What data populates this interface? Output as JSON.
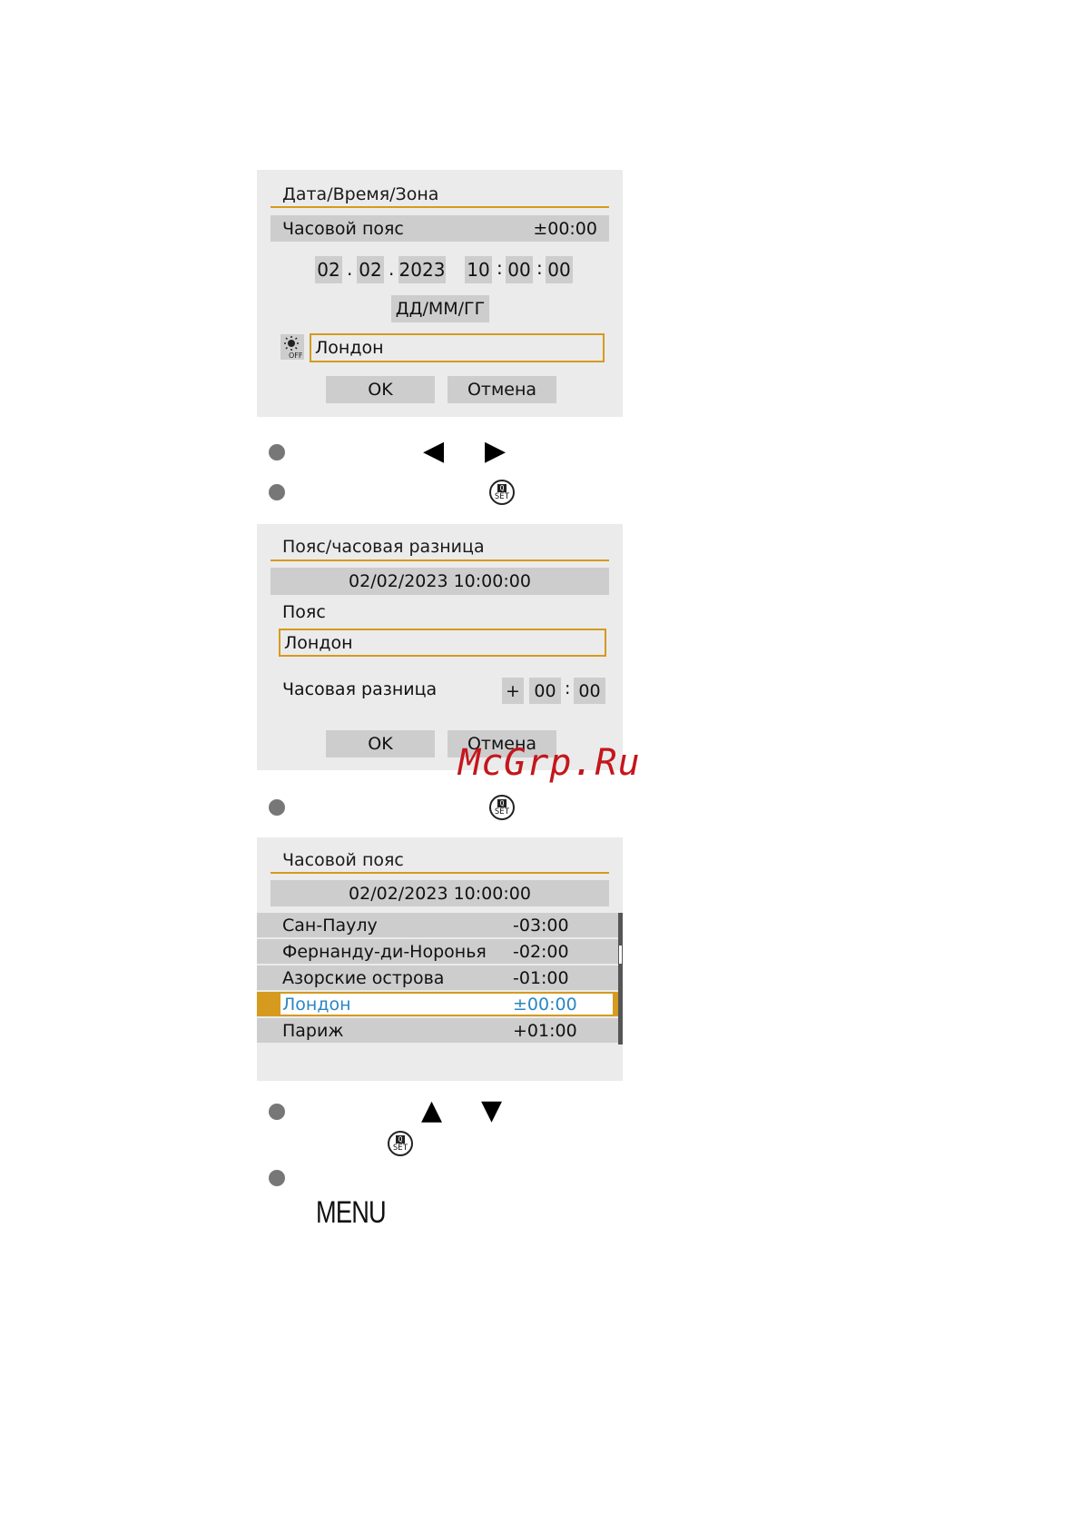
{
  "screen1": {
    "title": "Дата/Время/Зона",
    "zone_label": "Часовой пояс",
    "zone_value": "±00:00",
    "date": {
      "day": "02",
      "month": "02",
      "year": "2023",
      "sep": "."
    },
    "time": {
      "hour": "10",
      "minute": "00",
      "second": "00",
      "sep": ":"
    },
    "format": "ДД/ММ/ГГ",
    "dst_icon": "dst-off-icon",
    "city": "Лондон",
    "ok": "OK",
    "cancel": "Отмена"
  },
  "steps1": {
    "arrow_left": "◀",
    "arrow_right": "▶",
    "set_icon": "q-set-icon"
  },
  "screen2": {
    "title": "Пояс/часовая разница",
    "datetime": "02/02/2023 10:00:00",
    "zone_label": "Пояс",
    "city": "Лондон",
    "diff_label": "Часовая разница",
    "diff_sign": "+",
    "diff_hours": "00",
    "diff_sep": ":",
    "diff_minutes": "00",
    "ok": "OK",
    "cancel": "Отмена"
  },
  "watermark": "McGrp.Ru",
  "screen3": {
    "title": "Часовой пояс",
    "datetime": "02/02/2023 10:00:00",
    "rows": [
      {
        "name": "Сан-Паулу",
        "offset": "-03:00"
      },
      {
        "name": "Фернанду-ди-Норонья",
        "offset": "-02:00"
      },
      {
        "name": "Азорские острова",
        "offset": "-01:00"
      },
      {
        "name": "Лондон",
        "offset": "±00:00"
      },
      {
        "name": "Париж",
        "offset": "+01:00"
      }
    ],
    "selected_index": 3
  },
  "steps2": {
    "arrow_up": "▲",
    "arrow_down": "▼",
    "set_icon": "q-set-icon",
    "menu_label": "MENU"
  },
  "colors": {
    "accent": "#d69a1e",
    "highlight_text": "#2a86c2",
    "panel": "#ebebeb",
    "bar": "#cdcdcd"
  }
}
